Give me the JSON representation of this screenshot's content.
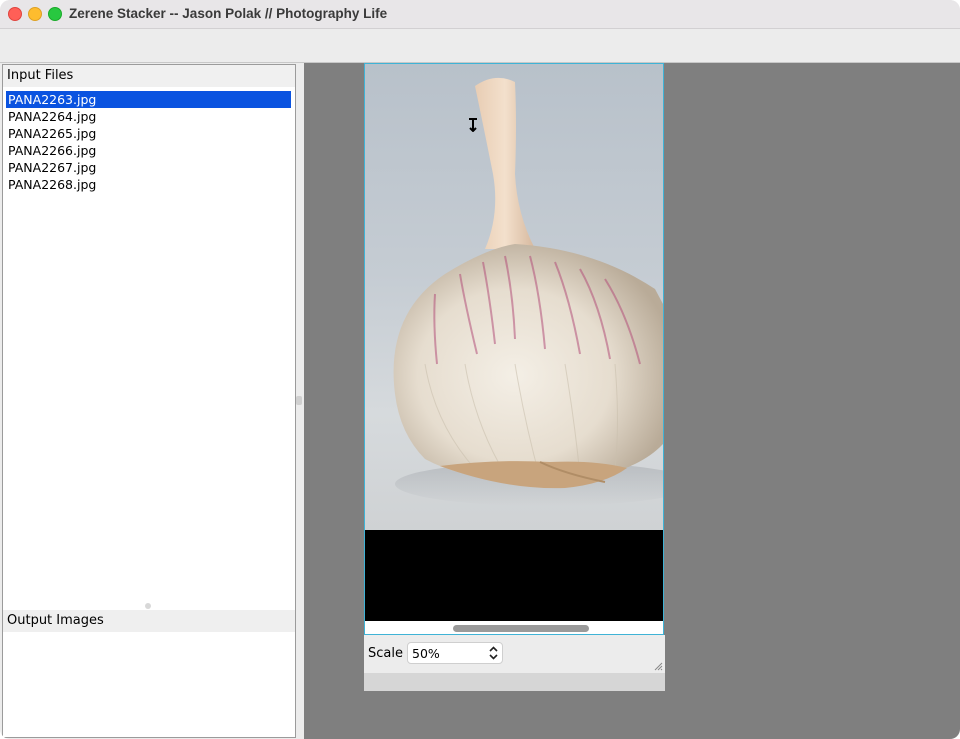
{
  "window": {
    "title": "Zerene Stacker -- Jason Polak // Photography Life"
  },
  "input_files": {
    "header": "Input Files",
    "selected_index": 0,
    "items": [
      "PANA2263.jpg",
      "PANA2264.jpg",
      "PANA2265.jpg",
      "PANA2266.jpg",
      "PANA2267.jpg",
      "PANA2268.jpg"
    ]
  },
  "output_images": {
    "header": "Output Images"
  },
  "viewer": {
    "scale_label": "Scale",
    "scale_value": "50%"
  },
  "colors": {
    "selection": "#0a53e0",
    "frame_border": "#3fb3d6",
    "viewer_bg": "#7f7f7f"
  }
}
